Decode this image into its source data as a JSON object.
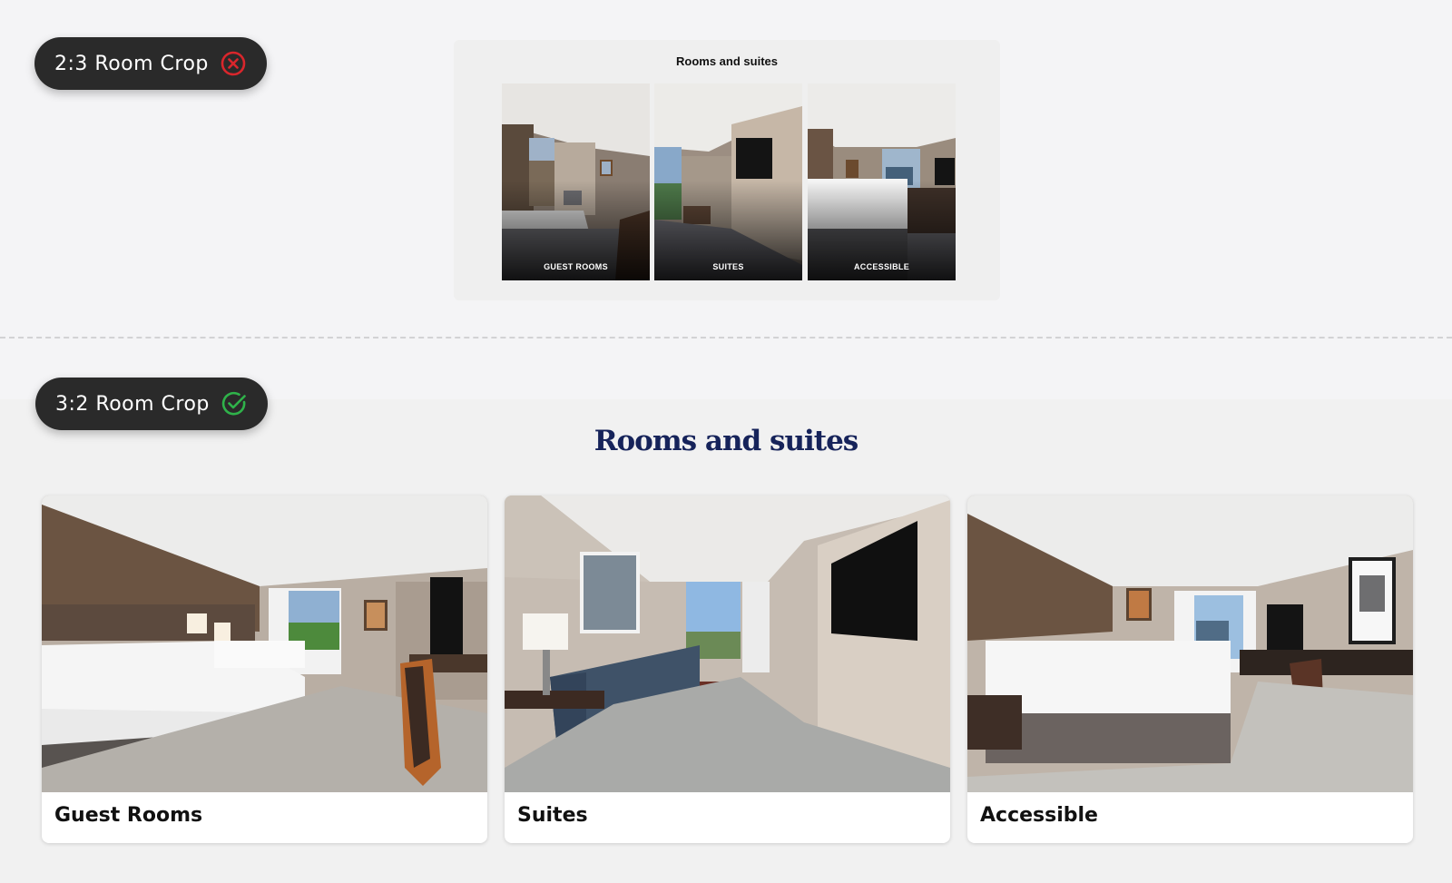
{
  "comparison_bad": {
    "label": "2:3 Room Crop",
    "status_icon": "x-circle-icon",
    "status_color": "#d9262c",
    "card_title": "Rooms and suites",
    "tiles": [
      {
        "label": "GUEST ROOMS"
      },
      {
        "label": "SUITES"
      },
      {
        "label": "ACCESSIBLE"
      }
    ]
  },
  "comparison_good": {
    "label": "3:2 Room Crop",
    "status_icon": "check-circle-icon",
    "status_color": "#2fb24a",
    "section_title": "Rooms and suites",
    "title_color": "#16235a",
    "cards": [
      {
        "label": "Guest Rooms"
      },
      {
        "label": "Suites"
      },
      {
        "label": "Accessible"
      }
    ]
  }
}
